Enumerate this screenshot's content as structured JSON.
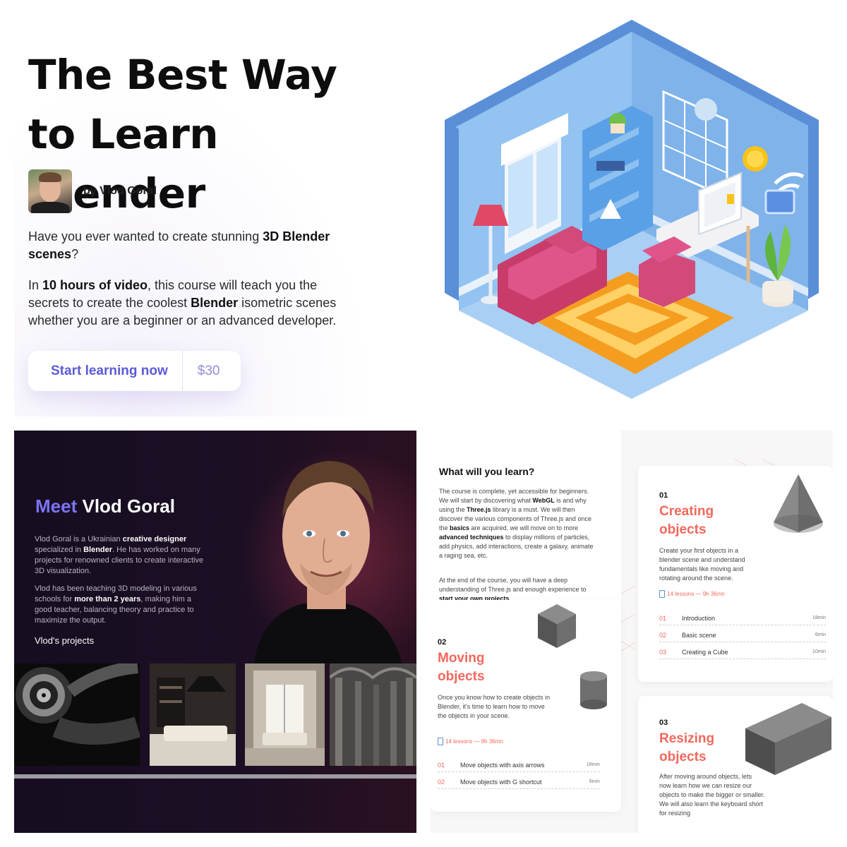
{
  "hero": {
    "title": "The Best Way to Learn Blender",
    "author": "by Vlod Goral",
    "p1_a": "Have you ever wanted to create stunning ",
    "p1_b": "3D Blender scenes",
    "p1_c": "?",
    "p2_a": "In ",
    "p2_b": "10 hours of video",
    "p2_c": ", this course will teach you the secrets to create the coolest ",
    "p2_d": "Blender",
    "p2_e": " isometric scenes whether you are a beginner or an advanced developer.",
    "cta_label": "Start learning now",
    "cta_price": "$30"
  },
  "meet": {
    "title_accent": "Meet",
    "title_name": " Vlod Goral",
    "p1_a": "Vlod Goral is a Ukrainian ",
    "p1_b": "creative designer",
    "p1_c": " specialized in ",
    "p1_d": "Blender",
    "p1_e": ". He has worked on many projects for renowned clients to create interactive 3D visualization.",
    "p2_a": "Vlod has been teaching 3D modeling in various schools for ",
    "p2_b": "more than 2 years",
    "p2_c": ", making him a good teacher, balancing theory and practice to maximize the output.",
    "projects_label": "Vlod's projects"
  },
  "learn": {
    "heading": "What will you learn?",
    "p1_a": "The course is complete, yet accessible for beginners. We will start by discovering what ",
    "p1_b": "WebGL",
    "p1_c": " is and why using the ",
    "p1_d": "Three.js",
    "p1_e": " library is a must. We will then discover the various components of Three.js and once the ",
    "p1_f": "basics",
    "p1_g": " are acquired, we will move on to more ",
    "p1_h": "advanced techniques",
    "p1_i": " to display millions of particles, add physics, add interactions, create a galaxy, animate a raging sea, etc.",
    "p2_a": "At the end of the course, you will have a deep understanding of Three.js and enough experience to ",
    "p2_b": "start your own projects",
    "p2_c": ".",
    "chapters": [
      {
        "num": "01",
        "title": "Creating objects",
        "desc": "Create your first objects in a blender scene and understand fundamentals like moving and rotating around the scene.",
        "meta": "14 lessons — 9h 36mn",
        "lessons": [
          {
            "n": "01",
            "t": "Introduction",
            "d": "18min"
          },
          {
            "n": "02",
            "t": "Basic scene",
            "d": "6min"
          },
          {
            "n": "03",
            "t": "Creating a Cube",
            "d": "10min"
          }
        ]
      },
      {
        "num": "02",
        "title": "Moving objects",
        "desc": "Once you know how to create objects in Blender, it's time to learn how to move the objects in your scene.",
        "meta": "14 lessons — 9h 36mn",
        "lessons": [
          {
            "n": "01",
            "t": "Move objects with axis arrows",
            "d": "18min"
          },
          {
            "n": "02",
            "t": "Move objects with G shortcut",
            "d": "6min"
          }
        ]
      },
      {
        "num": "03",
        "title": "Resizing objects",
        "desc": "After moving around objects, lets now learn how we can resize our objects to make the bigger or smaller.\nWe will also learn the keyboard short for resizing"
      }
    ]
  },
  "colors": {
    "accent_purple": "#5b5ad6",
    "accent_coral": "#f2685c",
    "dark_bg": "#160d21",
    "meet_accent": "#7b74f5"
  }
}
